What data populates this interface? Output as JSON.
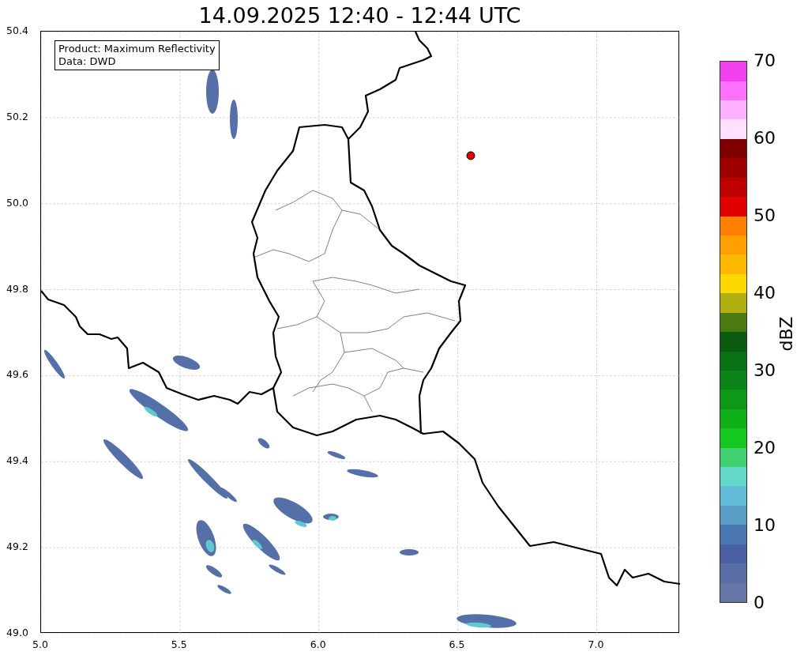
{
  "title": "14.09.2025 12:40 - 12:44 UTC",
  "legend": [
    "Product: Maximum Reflectivity",
    "Data: DWD"
  ],
  "x_ticks": [
    "5.0",
    "5.5",
    "6.0",
    "6.5",
    "7.0"
  ],
  "y_ticks": [
    "50.4",
    "50.2",
    "50.0",
    "49.8",
    "49.6",
    "49.4",
    "49.2",
    "49.0"
  ],
  "colorbar": {
    "label": "dBZ",
    "ticks": [
      "70",
      "60",
      "50",
      "40",
      "30",
      "20",
      "10",
      "0"
    ],
    "bins": [
      {
        "color": "#6778a8"
      },
      {
        "color": "#5a6ca6"
      },
      {
        "color": "#4a60a4"
      },
      {
        "color": "#4a78b0"
      },
      {
        "color": "#5a9ec8"
      },
      {
        "color": "#62bcd8"
      },
      {
        "color": "#62d8c8"
      },
      {
        "color": "#40d070"
      },
      {
        "color": "#14c820"
      },
      {
        "color": "#10b018"
      },
      {
        "color": "#0e9818"
      },
      {
        "color": "#0a8418"
      },
      {
        "color": "#0a7014"
      },
      {
        "color": "#0a5a10"
      },
      {
        "color": "#4a7a10"
      },
      {
        "color": "#b0b010"
      },
      {
        "color": "#ffd800"
      },
      {
        "color": "#ffb800"
      },
      {
        "color": "#ffa000"
      },
      {
        "color": "#ff8000"
      },
      {
        "color": "#e00000"
      },
      {
        "color": "#c00000"
      },
      {
        "color": "#a00000"
      },
      {
        "color": "#800000"
      },
      {
        "color": "#ffe0ff"
      },
      {
        "color": "#ffb0ff"
      },
      {
        "color": "#ff70ff"
      },
      {
        "color": "#f040f0"
      }
    ]
  }
}
